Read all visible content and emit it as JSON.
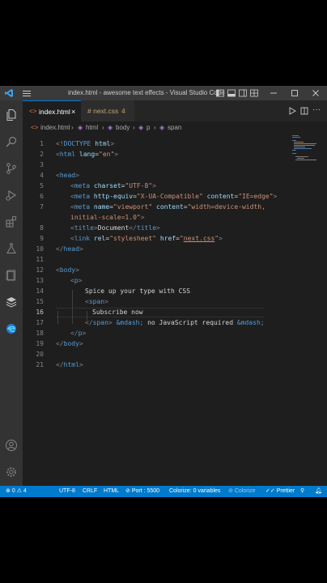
{
  "window": {
    "title": "index.html - awesome text effects - Visual Studio Code"
  },
  "tabs": [
    {
      "label": "index.html",
      "close": "×",
      "active": true
    },
    {
      "label": "# next.css",
      "badge": "4",
      "active": false
    }
  ],
  "breadcrumb": [
    "index.html",
    "html",
    "body",
    "p",
    "span"
  ],
  "code_lines": [
    {
      "n": "1",
      "text": "<!DOCTYPE html>"
    },
    {
      "n": "2",
      "text": "<html lang=\"en\">"
    },
    {
      "n": "3",
      "text": ""
    },
    {
      "n": "4",
      "text": "<head>"
    },
    {
      "n": "5",
      "text": "<meta charset=\"UTF-8\">"
    },
    {
      "n": "6",
      "text": "<meta http-equiv=\"X-UA-Compatible\" content=\"IE=edge\">"
    },
    {
      "n": "7",
      "text": "<meta name=\"viewport\" content=\"width=device-width,"
    },
    {
      "n": "",
      "text": "initial-scale=1.0\">"
    },
    {
      "n": "8",
      "text": "<title>Document</title>"
    },
    {
      "n": "9",
      "text": "<link rel=\"stylesheet\" href=\"next.css\">"
    },
    {
      "n": "10",
      "text": "</head>"
    },
    {
      "n": "11",
      "text": ""
    },
    {
      "n": "12",
      "text": "<body>"
    },
    {
      "n": "13",
      "text": "<p>"
    },
    {
      "n": "14",
      "text": "Spice up your type with CSS"
    },
    {
      "n": "15",
      "text": "<span>"
    },
    {
      "n": "16",
      "text": "Subscribe now"
    },
    {
      "n": "17",
      "text": "</span> &mdash; no JavaScript required &mdash;"
    },
    {
      "n": "18",
      "text": "</p>"
    },
    {
      "n": "19",
      "text": "</body>"
    },
    {
      "n": "20",
      "text": ""
    },
    {
      "n": "21",
      "text": "</html>"
    }
  ],
  "status": {
    "errors": "0",
    "warnings": "4",
    "encoding": "UTF-8",
    "eol": "CRLF",
    "language": "HTML",
    "port": "Port : 5500",
    "colorize_vars": "Colorize: 0 variables",
    "colorize": "Colorize",
    "prettier": "Prettier"
  },
  "colors": {
    "accent": "#007acc",
    "tag": "#569cd6",
    "attr": "#9cdcfe",
    "string": "#ce9178",
    "editor_bg": "#1e1e1e"
  }
}
